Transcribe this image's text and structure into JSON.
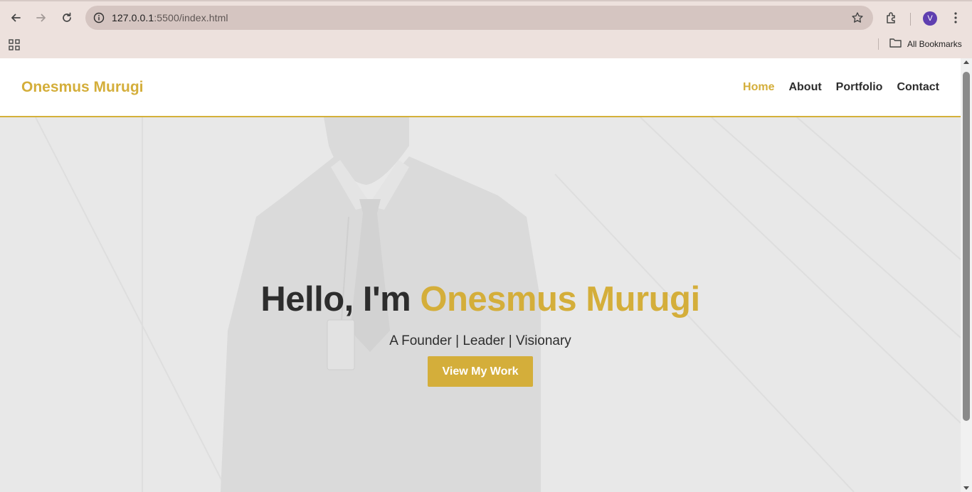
{
  "browser": {
    "url_host": "127.0.0.1",
    "url_path": ":5500/index.html",
    "profile_initial": "V",
    "bookmarks_label": "All Bookmarks",
    "icons": [
      "back-icon",
      "forward-icon",
      "reload-icon",
      "site-info-icon",
      "bookmark-star-icon",
      "extensions-icon",
      "menu-icon",
      "apps-grid-icon",
      "folder-icon"
    ]
  },
  "site": {
    "logo": "Onesmus Murugi",
    "nav": [
      {
        "label": "Home",
        "active": true
      },
      {
        "label": "About",
        "active": false
      },
      {
        "label": "Portfolio",
        "active": false
      },
      {
        "label": "Contact",
        "active": false
      }
    ],
    "hero": {
      "greeting": "Hello, I'm",
      "name": "Onesmus Murugi",
      "subtitle": "A Founder | Leader | Visionary",
      "button_label": "View My Work"
    }
  },
  "colors": {
    "accent": "#d4ae3a",
    "text": "#2d2d2d",
    "chrome": "#ede1dd",
    "omnibox": "#d5c5c1",
    "avatar": "#5f3fb0"
  }
}
